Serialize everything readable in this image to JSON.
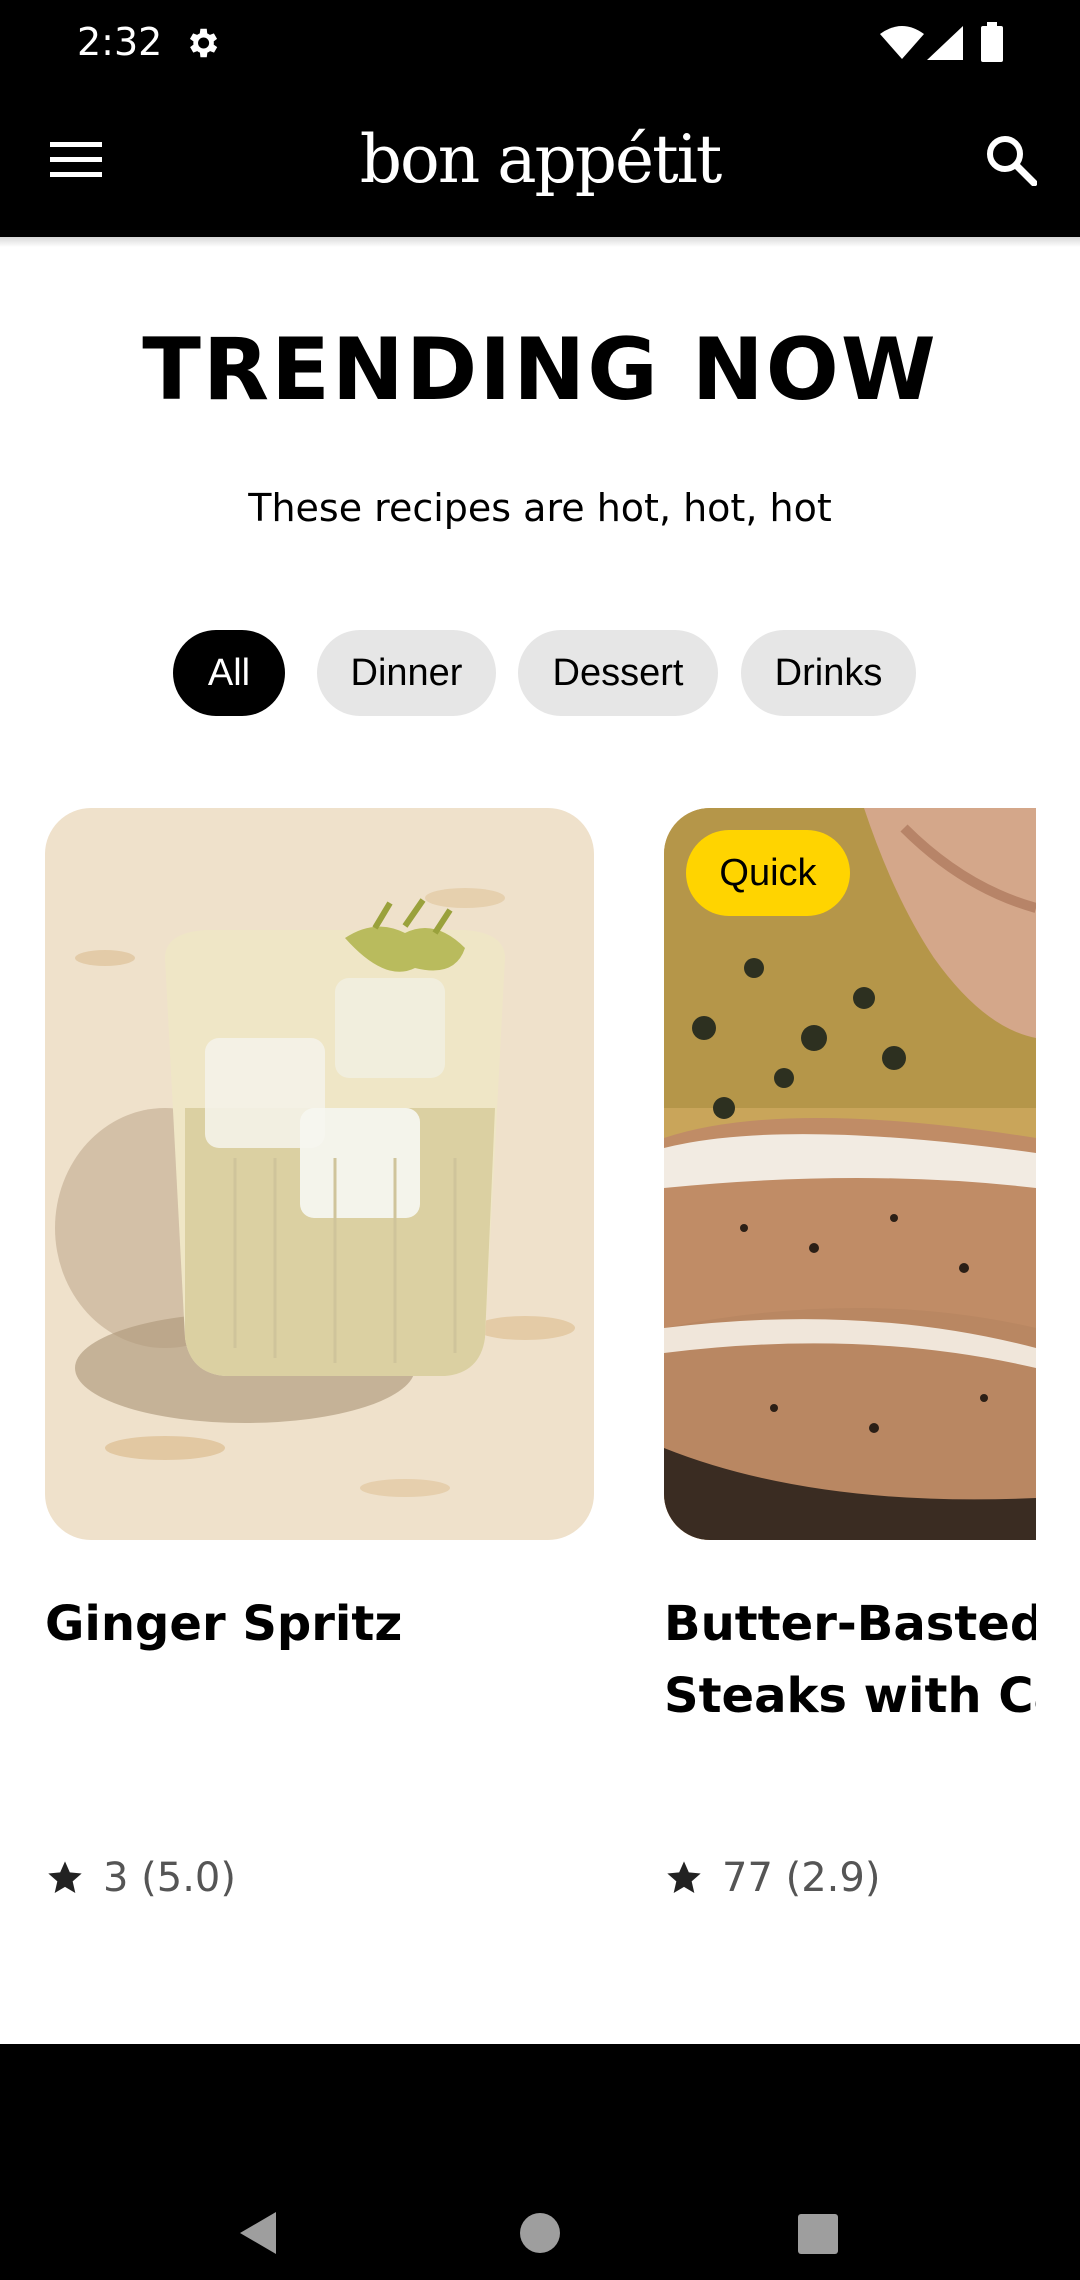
{
  "status_bar": {
    "time": "2:32",
    "icons": [
      "gear-icon",
      "wifi-icon",
      "signal-icon",
      "battery-icon"
    ]
  },
  "app_bar": {
    "brand": "bon appétit",
    "menu_icon": "menu-icon",
    "search_icon": "search-icon"
  },
  "section": {
    "title": "TRENDING NOW",
    "subtitle": "These recipes are hot, hot, hot"
  },
  "chips": [
    {
      "label": "All",
      "active": true
    },
    {
      "label": "Dinner",
      "active": false
    },
    {
      "label": "Dessert",
      "active": false
    },
    {
      "label": "Drinks",
      "active": false
    }
  ],
  "cards": [
    {
      "title": "Ginger Spritz",
      "badge": "",
      "rating": "3 (5.0)",
      "star_icon": "star-icon"
    },
    {
      "title_line1": "Butter-Basted H",
      "title_line2": "Steaks with Ca",
      "badge": "Quick",
      "rating": "77 (2.9)",
      "star_icon": "star-icon"
    }
  ],
  "colors": {
    "bar_background": "#000000",
    "chip_inactive": "#e6e6e6",
    "chip_active": "#000000",
    "badge_quick": "#ffd400",
    "rating_text": "#555555"
  },
  "nav_bar": {
    "icons": [
      "back-icon",
      "home-icon",
      "recents-icon"
    ]
  }
}
